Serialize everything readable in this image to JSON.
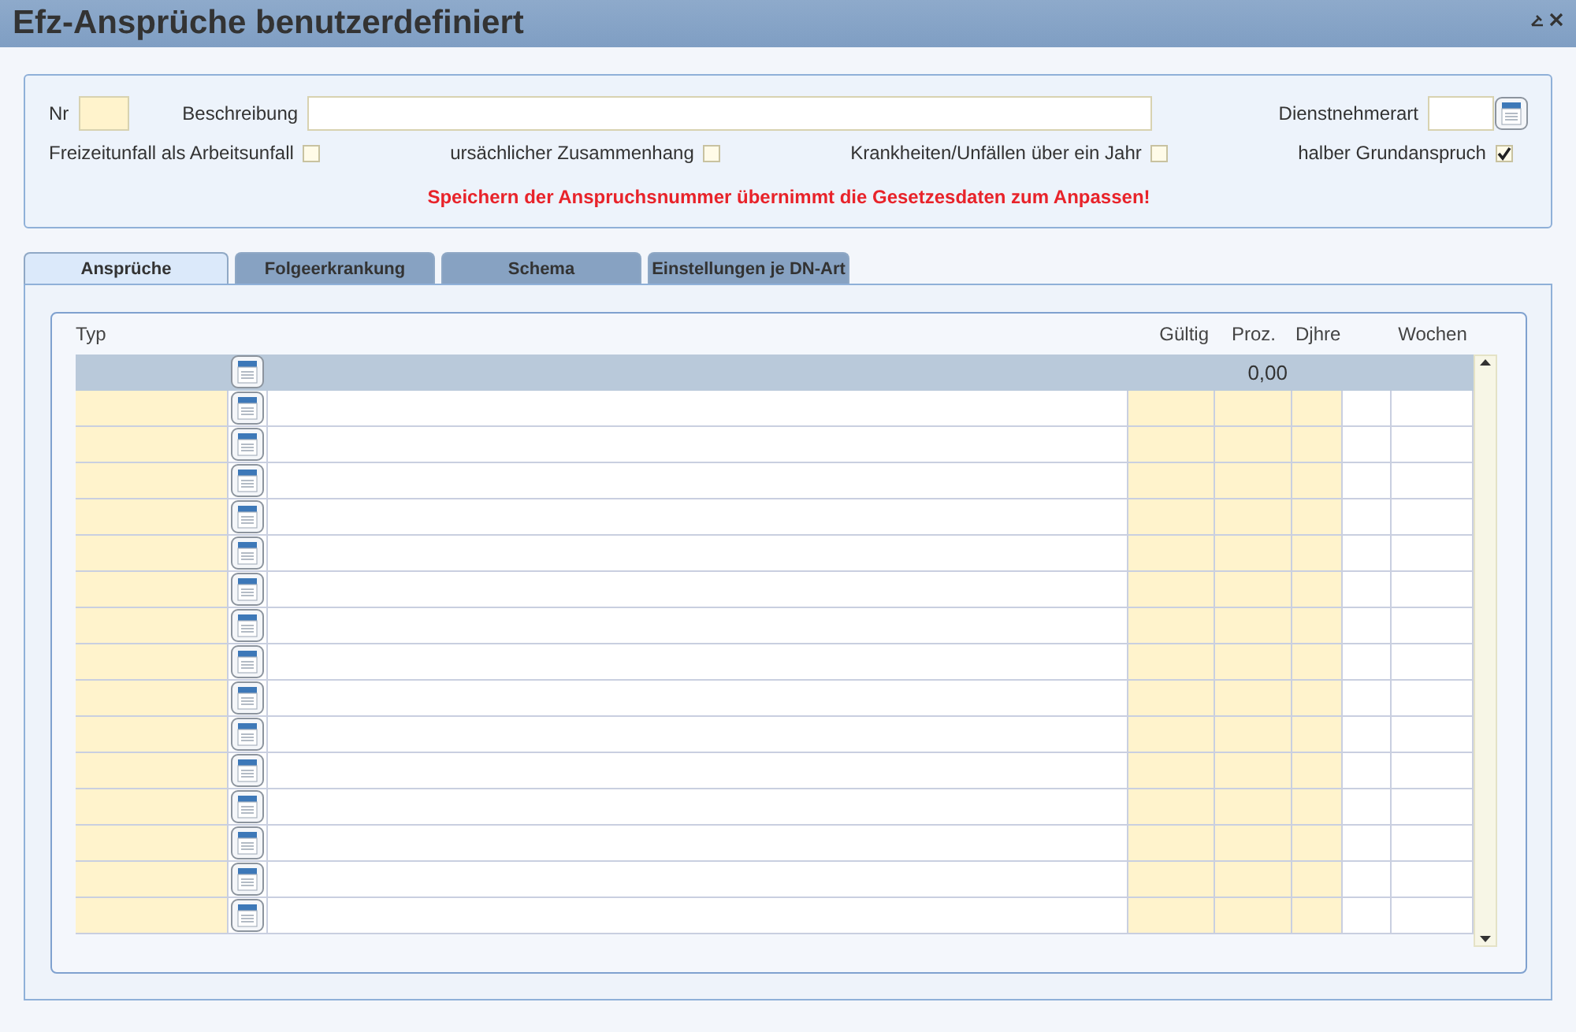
{
  "window": {
    "title": "Efz-Ansprüche benutzerdefiniert"
  },
  "form": {
    "nr_label": "Nr",
    "beschreibung_label": "Beschreibung",
    "dienstnehmerart_label": "Dienstnehmerart",
    "checkboxes": [
      {
        "label": "Freizeitunfall als Arbeitsunfall",
        "checked": false
      },
      {
        "label": "ursächlicher Zusammenhang",
        "checked": false
      },
      {
        "label": "Krankheiten/Unfällen über ein Jahr",
        "checked": false
      },
      {
        "label": "halber Grundanspruch",
        "checked": true
      }
    ],
    "warning": "Speichern der Anspruchsnummer übernimmt die Gesetzesdaten zum Anpassen!"
  },
  "tabs": [
    {
      "label": "Ansprüche",
      "selected": true
    },
    {
      "label": "Folgeerkrankung",
      "selected": false
    },
    {
      "label": "Schema",
      "selected": false
    },
    {
      "label": "Einstellungen je DN-Art",
      "selected": false
    }
  ],
  "table": {
    "columns": [
      "Typ",
      "Gültig",
      "Proz.",
      "Djhre",
      "Wochen"
    ],
    "filter_row": {
      "proz": "0,00"
    }
  }
}
